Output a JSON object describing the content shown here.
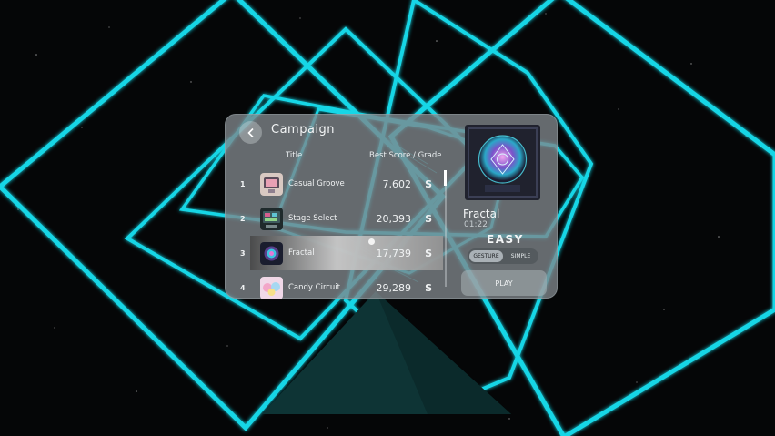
{
  "header": {
    "title": "Campaign"
  },
  "columns": {
    "title": "Title",
    "score": "Best Score / Grade"
  },
  "songs": [
    {
      "rank": "1",
      "name": "Casual Groove",
      "score": "7,602",
      "grade": "S",
      "icon": "casual-groove-thumbnail"
    },
    {
      "rank": "2",
      "name": "Stage Select",
      "score": "20,393",
      "grade": "S",
      "icon": "stage-select-thumbnail"
    },
    {
      "rank": "3",
      "name": "Fractal",
      "score": "17,739",
      "grade": "S",
      "icon": "fractal-thumbnail",
      "selected": true
    },
    {
      "rank": "4",
      "name": "Candy Circuit",
      "score": "29,289",
      "grade": "S",
      "icon": "candy-circuit-thumbnail"
    }
  ],
  "details": {
    "name": "Fractal",
    "duration": "01:22",
    "difficulty": "EASY",
    "modes": [
      "GESTURE",
      "SIMPLE"
    ],
    "selected_mode": "GESTURE",
    "play_label": "PLAY"
  },
  "colors": {
    "neon": "#19d6e6",
    "background": "#050607",
    "panel": "#80878c"
  }
}
